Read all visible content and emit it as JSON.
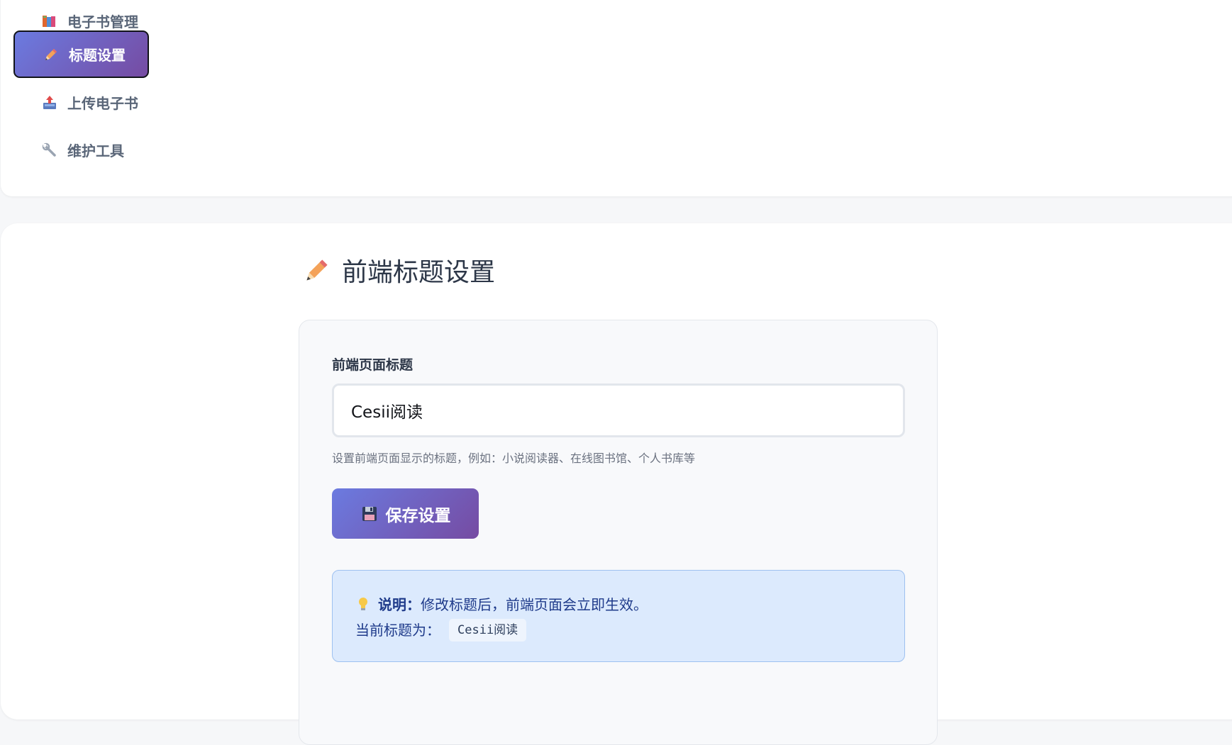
{
  "nav": {
    "items": [
      {
        "label": "电子书管理",
        "icon": "books-icon",
        "active": false
      },
      {
        "label": "标题设置",
        "icon": "pencil-icon",
        "active": true
      },
      {
        "label": "上传电子书",
        "icon": "upload-tray-icon",
        "active": false
      },
      {
        "label": "维护工具",
        "icon": "wrench-icon",
        "active": false
      }
    ]
  },
  "main": {
    "heading": "前端标题设置",
    "heading_icon": "pencil-icon",
    "form": {
      "label": "前端页面标题",
      "input_value": "Cesii阅读",
      "hint": "设置前端页面显示的标题，例如：小说阅读器、在线图书馆、个人书库等",
      "save_label": "保存设置",
      "save_icon": "floppy-disk-icon"
    },
    "info": {
      "icon": "lightbulb-icon",
      "strong": "说明：",
      "text": "修改标题后，前端页面会立即生效。",
      "current_label": "当前标题为：",
      "current_value": "Cesii阅读"
    }
  },
  "colors": {
    "accent_start": "#6b7be0",
    "accent_end": "#764ba2",
    "info_bg": "#dceafd",
    "info_border": "#9ec1f0",
    "info_text": "#1e3a8a"
  }
}
